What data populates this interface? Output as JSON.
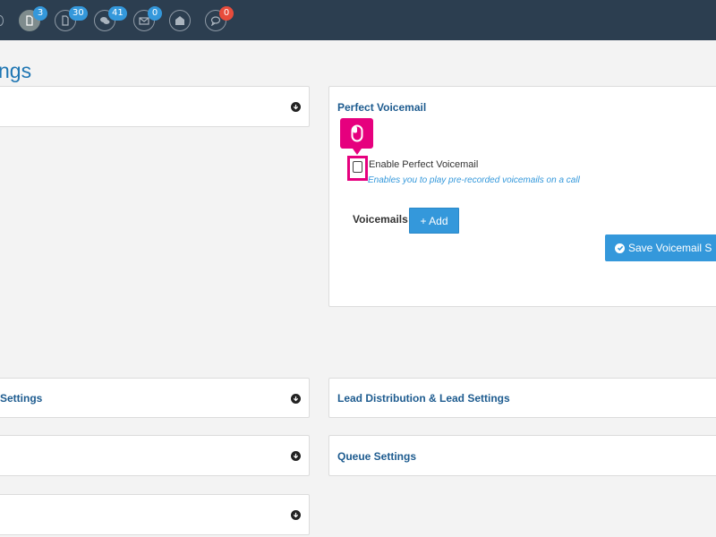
{
  "header": {
    "icons": [
      {
        "name": "document-icon",
        "badge": "3",
        "badge_color": "#3498db",
        "active": true
      },
      {
        "name": "voicemail-document-icon",
        "badge": "30",
        "badge_color": "#3498db"
      },
      {
        "name": "chat-bubbles-icon",
        "badge": "41",
        "badge_color": "#3498db"
      },
      {
        "name": "envelope-icon",
        "badge": "0",
        "badge_color": "#3498db"
      },
      {
        "name": "open-envelope-icon"
      },
      {
        "name": "comment-icon",
        "badge": "0",
        "badge_color": "#e74c3c"
      }
    ]
  },
  "page": {
    "title": "ngs"
  },
  "panels": {
    "left_top": {
      "title": ""
    },
    "perfect_voicemail": {
      "title": "Perfect Voicemail",
      "enable_label": "Enable Perfect Voicemail",
      "enable_help": "Enables you to play pre-recorded voicemails on a call",
      "enable_checked": false,
      "voicemails_label": "Voicemails",
      "add_button": "+ Add",
      "save_button": "Save Voicemail S"
    },
    "left_mid": {
      "title": "Settings"
    },
    "lead_distribution": {
      "title": "Lead Distribution & Lead Settings"
    },
    "left_lower": {
      "title": ""
    },
    "queue": {
      "title": "Queue Settings"
    },
    "left_bottom": {
      "title": ""
    }
  },
  "colors": {
    "topbar": "#2c3e50",
    "accent": "#3498db",
    "highlight": "#e6007e",
    "panel_title": "#1d5b8f",
    "page_title": "#1f76b3"
  }
}
